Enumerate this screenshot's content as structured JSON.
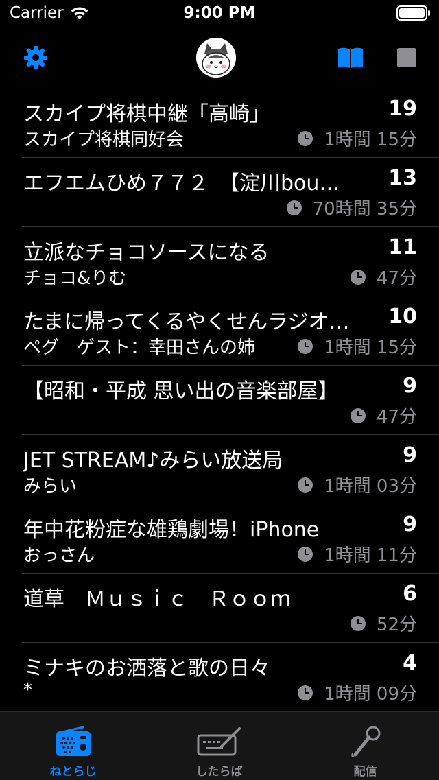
{
  "status_bar": {
    "carrier": "Carrier",
    "time": "9:00 PM"
  },
  "nav": {
    "settings_icon": "gear-icon",
    "book_icon": "book-icon",
    "stop_icon": "stop-icon",
    "accent": "#0a84ff"
  },
  "programs": [
    {
      "title": "スカイプ将棋中継「高崎」",
      "count": "19",
      "subtitle": "スカイプ将棋同好会",
      "duration": "1時間 15分"
    },
    {
      "title": "エフエムひめ７７２　【淀川bou…",
      "count": "13",
      "subtitle": "",
      "duration": "70時間 35分"
    },
    {
      "title": "立派なチョコソースになる",
      "count": "11",
      "subtitle": "チョコ&りむ",
      "duration": "47分"
    },
    {
      "title": "たまに帰ってくるやくせんラジオ…",
      "count": "10",
      "subtitle": "ペグ　ゲスト：幸田さんの姉",
      "duration": "1時間 15分"
    },
    {
      "title": "【昭和・平成 思い出の音楽部屋】",
      "count": "9",
      "subtitle": "",
      "duration": "47分"
    },
    {
      "title": "JET STREAM♪みらい放送局",
      "count": "9",
      "subtitle": "みらい",
      "duration": "1時間 03分"
    },
    {
      "title": "年中花粉症な雄鶏劇場！iPhone",
      "count": "9",
      "subtitle": "おっさん",
      "duration": "1時間 11分"
    },
    {
      "title": "道草　Ｍｕｓｉｃ　Ｒｏｏｍ",
      "count": "6",
      "subtitle": "",
      "duration": "52分"
    },
    {
      "title": "ミナキのお洒落と歌の日々",
      "count": "4",
      "subtitle": "*",
      "duration": "1時間 09分"
    }
  ],
  "tabs": [
    {
      "label": "ねとらじ",
      "icon": "radio-icon",
      "active": true
    },
    {
      "label": "したらば",
      "icon": "keyboard-pen-icon",
      "active": false
    },
    {
      "label": "配信",
      "icon": "microphone-icon",
      "active": false
    }
  ],
  "colors": {
    "accent": "#0a84ff",
    "inactive": "#8e8e93"
  }
}
